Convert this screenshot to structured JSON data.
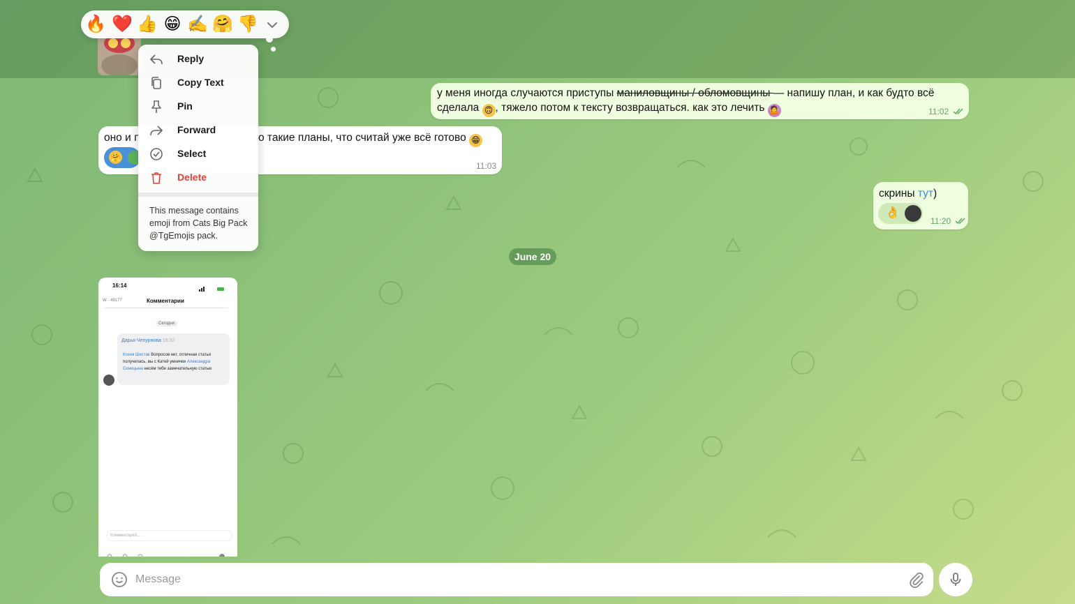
{
  "reactions": [
    "🔥",
    "❤️",
    "👍",
    "😁",
    "✍️",
    "🤗",
    "👎"
  ],
  "reactions_more_icon": "chevron-down-icon",
  "messages": [
    {
      "direction": "out",
      "text_before_strike": "у меня иногда случаются приступы ",
      "text_strike": "маниловщины / обломовщины ",
      "text_after_strike_line1": "— напишу план, и как будто всё",
      "text_line2_a": "сделала",
      "text_line2_b": ", тяжело потом к тексту возвращаться. как это лечить",
      "time": "11:02"
    },
    {
      "direction": "in",
      "text_visible_left": "оно и п",
      "text_visible_right": "о такие планы, что считай уже всё готово",
      "time": "11:03"
    },
    {
      "direction": "out",
      "text": "скрины ",
      "link_text": "тут",
      "text_after": ")",
      "time": "11:20"
    }
  ],
  "date_separator": "June 20",
  "context_menu": {
    "items": [
      {
        "label": "Reply",
        "icon": "reply-icon"
      },
      {
        "label": "Copy Text",
        "icon": "copy-icon"
      },
      {
        "label": "Pin",
        "icon": "pin-icon"
      },
      {
        "label": "Forward",
        "icon": "forward-icon"
      },
      {
        "label": "Select",
        "icon": "select-check-icon"
      },
      {
        "label": "Delete",
        "icon": "trash-icon",
        "danger": true
      }
    ],
    "note": "This message contains emoji from Cats Big Pack @TgEmojis pack."
  },
  "screenshot": {
    "status_time": "16:14",
    "nav_back": "W - 49177",
    "nav_title": "Комментарии",
    "date_chip": "Сегодня",
    "author": "Дарья Чепурнова",
    "author_meta": "16:32",
    "mention1": "Ксеня Шестак",
    "body1": " Вопросов нет, отличная статья получилась, вы с Катей умнички",
    "mention2": "Александра Синицына",
    "body2": " несём тебе замечательную статью",
    "input_placeholder": "Комментарий..."
  },
  "composer": {
    "placeholder": "Message",
    "emoji_icon": "smile-icon",
    "attach_icon": "paperclip-icon",
    "mic_icon": "microphone-icon"
  },
  "colors": {
    "outgoing_bubble": "#eefedf",
    "incoming_bubble": "#ffffff",
    "accent_green": "#5ea85e",
    "link_blue": "#3a8fd8",
    "danger": "#e0413b"
  }
}
